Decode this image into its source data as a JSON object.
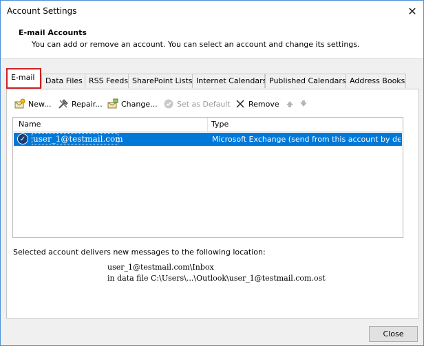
{
  "window": {
    "title": "Account Settings",
    "close_glyph": "✕"
  },
  "header": {
    "title": "E-mail Accounts",
    "description": "You can add or remove an account. You can select an account and change its settings."
  },
  "tabs": [
    {
      "label": "E-mail",
      "active": true
    },
    {
      "label": "Data Files"
    },
    {
      "label": "RSS Feeds"
    },
    {
      "label": "SharePoint Lists"
    },
    {
      "label": "Internet Calendars"
    },
    {
      "label": "Published Calendars"
    },
    {
      "label": "Address Books"
    }
  ],
  "toolbar": {
    "new_label": "New...",
    "repair_label": "Repair...",
    "change_label": "Change...",
    "default_label": "Set as Default",
    "remove_label": "Remove"
  },
  "list": {
    "columns": [
      "Name",
      "Type"
    ],
    "rows": [
      {
        "name": "user_1@testmail.com",
        "type": "Microsoft Exchange (send from this account by def..."
      }
    ]
  },
  "delivery": {
    "label": "Selected account delivers new messages to the following location:",
    "inbox": "user_1@testmail.com\\Inbox",
    "file": "in data file C:\\Users\\...\\Outlook\\user_1@testmail.com.ost"
  },
  "footer": {
    "close_label": "Close"
  },
  "colors": {
    "accent": "#0078d7",
    "highlight_border": "#cc2020"
  }
}
